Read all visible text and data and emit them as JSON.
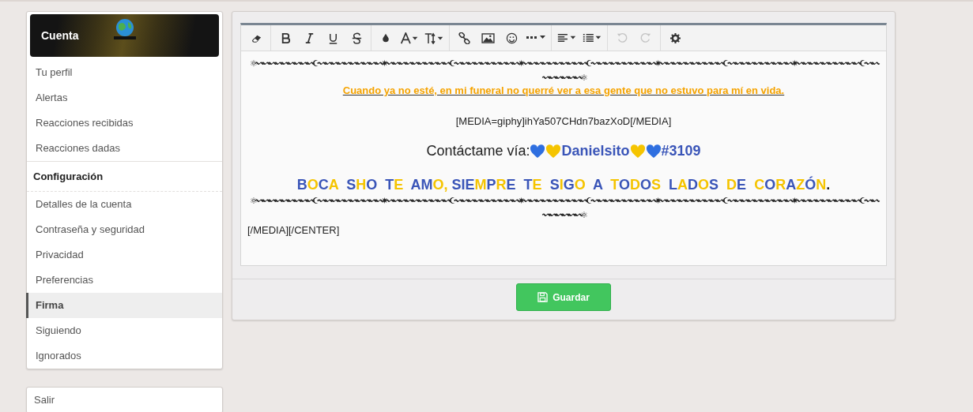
{
  "sidebar": {
    "header": {
      "title": "Cuenta"
    },
    "groups": [
      {
        "items": [
          {
            "label": "Tu perfil",
            "selected": false
          },
          {
            "label": "Alertas",
            "selected": false
          },
          {
            "label": "Reacciones recibidas",
            "selected": false
          },
          {
            "label": "Reacciones dadas",
            "selected": false
          }
        ]
      },
      {
        "heading": "Configuración",
        "items": [
          {
            "label": "Detalles de la cuenta",
            "selected": false
          },
          {
            "label": "Contraseña y seguridad",
            "selected": false
          },
          {
            "label": "Privacidad",
            "selected": false
          },
          {
            "label": "Preferencias",
            "selected": false
          },
          {
            "label": "Firma",
            "selected": true
          },
          {
            "label": "Siguiendo",
            "selected": false
          },
          {
            "label": "Ignorados",
            "selected": false
          }
        ]
      }
    ],
    "logout": {
      "label": "Salir"
    }
  },
  "editor": {
    "toolbar": [
      {
        "kind": "eraser",
        "disabled": false
      },
      {
        "kind": "sep"
      },
      {
        "kind": "bold",
        "disabled": false
      },
      {
        "kind": "italic",
        "disabled": false
      },
      {
        "kind": "underline",
        "disabled": false
      },
      {
        "kind": "strike",
        "disabled": false
      },
      {
        "kind": "sep"
      },
      {
        "kind": "drop",
        "disabled": false
      },
      {
        "kind": "font",
        "disabled": false
      },
      {
        "kind": "size",
        "disabled": false
      },
      {
        "kind": "sep"
      },
      {
        "kind": "link",
        "disabled": false
      },
      {
        "kind": "image",
        "disabled": false
      },
      {
        "kind": "smile",
        "disabled": false
      },
      {
        "kind": "more",
        "disabled": false
      },
      {
        "kind": "sep"
      },
      {
        "kind": "align",
        "disabled": false
      },
      {
        "kind": "list",
        "disabled": false
      },
      {
        "kind": "sep"
      },
      {
        "kind": "undo",
        "disabled": true
      },
      {
        "kind": "redo",
        "disabled": true
      },
      {
        "kind": "sep"
      },
      {
        "kind": "gear",
        "disabled": false
      }
    ],
    "content": [
      {
        "kind": "ornament",
        "text": "⚛〰〰〰〰〰〰〰〰〰☪〰〰〰〰〰〰〰〰〰〰✷〰〰〰〰〰〰〰〰〰〰☪〰〰〰〰〰〰〰〰〰〰✷〰〰〰〰〰〰〰〰〰〰☪〰〰〰〰〰〰〰〰〰〰✷〰〰〰〰〰〰〰〰〰〰☪〰〰〰〰〰〰〰〰〰〰✷〰〰〰〰〰〰〰〰〰〰☪〰〰〰〰〰〰〰〰⚛"
      },
      {
        "kind": "quote",
        "text": "Cuando ya no esté, en mi funeral no querré ver a esa gente que no estuvo para mí en vida."
      },
      {
        "kind": "plain",
        "text": "[MEDIA=giphy]ihYa507CHdn7bazXoD[/MEDIA]"
      },
      {
        "kind": "contact",
        "label": "Contáctame vía:",
        "hearts_before": [
          {
            "color": "#2f6fe0"
          },
          {
            "color": "#f5c400"
          }
        ],
        "name": "Danielsito",
        "hearts_after": [
          {
            "color": "#f5c400"
          },
          {
            "color": "#2f6fe0"
          }
        ],
        "tag": "#3109"
      },
      {
        "kind": "colored",
        "runs": [
          {
            "text": "B",
            "color": "#3a55b8"
          },
          {
            "text": "O",
            "color": "#f5c400"
          },
          {
            "text": "C",
            "color": "#3a55b8"
          },
          {
            "text": "A  ",
            "color": "#f5c400"
          },
          {
            "text": "S",
            "color": "#3a55b8"
          },
          {
            "text": "H",
            "color": "#f5c400"
          },
          {
            "text": "O  ",
            "color": "#3a55b8"
          },
          {
            "text": "T",
            "color": "#3a55b8"
          },
          {
            "text": "E  ",
            "color": "#f5c400"
          },
          {
            "text": "AM",
            "color": "#3a55b8"
          },
          {
            "text": "O, ",
            "color": "#f5c400"
          },
          {
            "text": "SIE",
            "color": "#3a55b8"
          },
          {
            "text": "M",
            "color": "#f5c400"
          },
          {
            "text": "P",
            "color": "#3a55b8"
          },
          {
            "text": "R",
            "color": "#f5c400"
          },
          {
            "text": "E  ",
            "color": "#3a55b8"
          },
          {
            "text": "T",
            "color": "#3a55b8"
          },
          {
            "text": "E  ",
            "color": "#f5c400"
          },
          {
            "text": "S",
            "color": "#3a55b8"
          },
          {
            "text": "I",
            "color": "#f5c400"
          },
          {
            "text": "G",
            "color": "#3a55b8"
          },
          {
            "text": "O  ",
            "color": "#f5c400"
          },
          {
            "text": "A  ",
            "color": "#3a55b8"
          },
          {
            "text": "T",
            "color": "#f5c400"
          },
          {
            "text": "O",
            "color": "#3a55b8"
          },
          {
            "text": "D",
            "color": "#f5c400"
          },
          {
            "text": "O",
            "color": "#3a55b8"
          },
          {
            "text": "S  ",
            "color": "#f5c400"
          },
          {
            "text": "L",
            "color": "#3a55b8"
          },
          {
            "text": "A",
            "color": "#f5c400"
          },
          {
            "text": "D",
            "color": "#3a55b8"
          },
          {
            "text": "O",
            "color": "#f5c400"
          },
          {
            "text": "S  ",
            "color": "#3a55b8"
          },
          {
            "text": "D",
            "color": "#f5c400"
          },
          {
            "text": "E  ",
            "color": "#3a55b8"
          },
          {
            "text": "C",
            "color": "#f5c400"
          },
          {
            "text": "O",
            "color": "#3a55b8"
          },
          {
            "text": "R",
            "color": "#f5c400"
          },
          {
            "text": "A",
            "color": "#3a55b8"
          },
          {
            "text": "Z",
            "color": "#f5c400"
          },
          {
            "text": "Ó",
            "color": "#3a55b8"
          },
          {
            "text": "N",
            "color": "#f5c400"
          },
          {
            "text": ".",
            "color": "#222222"
          }
        ]
      },
      {
        "kind": "ornament",
        "text": "⚛〰〰〰〰〰〰〰〰〰☪〰〰〰〰〰〰〰〰〰〰✷〰〰〰〰〰〰〰〰〰〰☪〰〰〰〰〰〰〰〰〰〰✷〰〰〰〰〰〰〰〰〰〰☪〰〰〰〰〰〰〰〰〰〰✷〰〰〰〰〰〰〰〰〰〰☪〰〰〰〰〰〰〰〰〰〰✷〰〰〰〰〰〰〰〰〰〰☪〰〰〰〰〰〰〰〰⚛"
      },
      {
        "kind": "left",
        "text": "[/MEDIA][/CENTER]"
      }
    ]
  },
  "save_button": {
    "label": "Guardar"
  }
}
